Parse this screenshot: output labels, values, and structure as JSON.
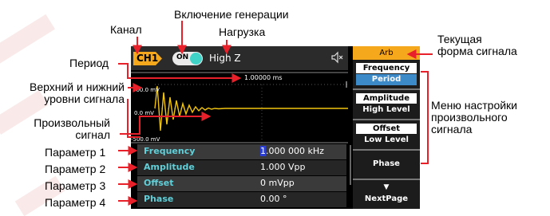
{
  "annotations": {
    "channel": "Канал",
    "output_on": "Включение генерации",
    "load": "Нагрузка",
    "period": "Период",
    "levels": "Верхний и нижний\nуровни сигнала",
    "arb_signal": "Произвольный\nсигнал",
    "param1": "Параметр 1",
    "param2": "Параметр 2",
    "param3": "Параметр 3",
    "param4": "Параметр 4",
    "current_wave": "Текущая\nформа сигнала",
    "menu_desc": "Меню настройки\nпроизвольного\nсигнала"
  },
  "screen": {
    "channel": "CH1",
    "output_toggle": "ON",
    "load": "High Z",
    "period_value": "1.00000 ms",
    "high_level": "500.0 mV",
    "mid_level": "0.0 mV",
    "low_level": "-500.0 mV",
    "params": [
      {
        "name": "Frequency",
        "value_cursor": "1",
        "value_rest": ".000 000 kHz"
      },
      {
        "name": "Amplitude",
        "value_cursor": "",
        "value_rest": "1.000 Vpp"
      },
      {
        "name": "Offset",
        "value_cursor": "",
        "value_rest": "0 mVpp"
      },
      {
        "name": "Phase",
        "value_cursor": "",
        "value_rest": "0.00 °"
      }
    ],
    "menu": {
      "title": "Arb",
      "items": [
        {
          "top": "Frequency",
          "bottom": "Period"
        },
        {
          "top": "Amplitude",
          "bottom": "High Level"
        },
        {
          "top": "Offset",
          "bottom": "Low Level"
        }
      ],
      "phase": "Phase",
      "next_arrow": "▼",
      "next": "NextPage"
    }
  },
  "colors": {
    "accent_orange": "#f5a81c",
    "param_cyan": "#5fd0d9",
    "selected_blue": "#3c8ac8",
    "arrow_red": "#e8202a",
    "wave_yellow": "#f1c40f"
  },
  "icons": {
    "mute": "speaker-muted-icon",
    "next": "triangle-down-icon"
  }
}
